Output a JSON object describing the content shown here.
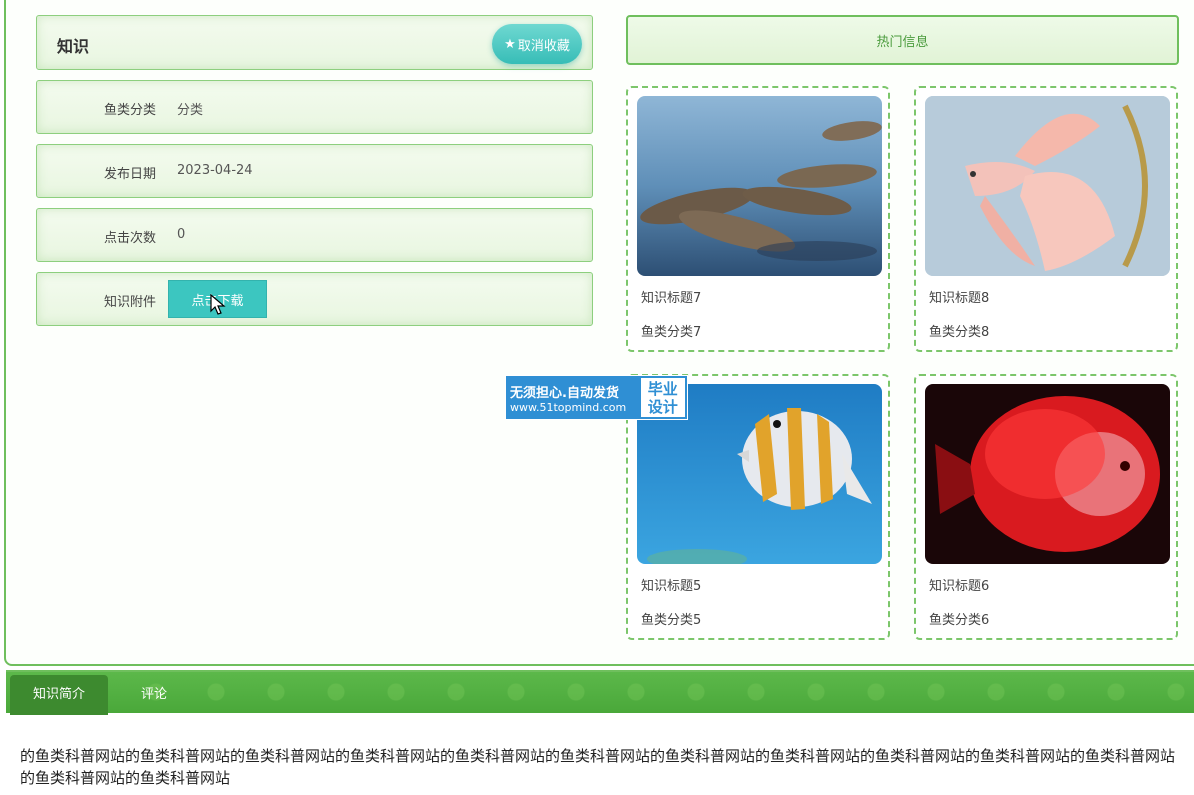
{
  "knowledge": {
    "title": "知识",
    "unfavorite_label": "取消收藏",
    "fields": [
      {
        "label": "鱼类分类",
        "value": "分类"
      },
      {
        "label": "发布日期",
        "value": "2023-04-24"
      },
      {
        "label": "点击次数",
        "value": "0"
      }
    ],
    "attachment_label": "知识附件",
    "download_label": "点击下载"
  },
  "hot": {
    "header": "热门信息",
    "cards": [
      {
        "title": "知识标题7",
        "category": "鱼类分类7"
      },
      {
        "title": "知识标题8",
        "category": "鱼类分类8"
      },
      {
        "title": "知识标题5",
        "category": "鱼类分类5"
      },
      {
        "title": "知识标题6",
        "category": "鱼类分类6"
      }
    ]
  },
  "watermark": {
    "line1": "无须担心.自动发货",
    "line2": "www.51topmind.com",
    "badge1": "毕业",
    "badge2": "设计"
  },
  "tabs": {
    "intro": "知识简介",
    "comments": "评论"
  },
  "intro_text": "的鱼类科普网站的鱼类科普网站的鱼类科普网站的鱼类科普网站的鱼类科普网站的鱼类科普网站的鱼类科普网站的鱼类科普网站的鱼类科普网站的鱼类科普网站的鱼类科普网站的鱼类科普网站的鱼类科普网站",
  "colors": {
    "accent_green": "#6fbf5d",
    "button_teal": "#3cc6c0",
    "tab_green": "#4aa83a"
  }
}
